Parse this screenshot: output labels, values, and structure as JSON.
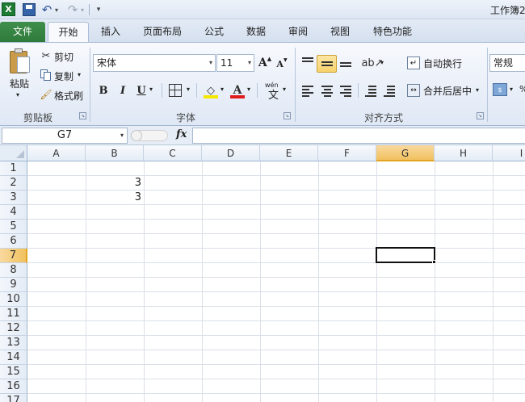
{
  "window": {
    "title": "工作簿2"
  },
  "quick_access": {
    "more_label": "▾"
  },
  "tabs": [
    {
      "label": "文件"
    },
    {
      "label": "开始"
    },
    {
      "label": "插入"
    },
    {
      "label": "页面布局"
    },
    {
      "label": "公式"
    },
    {
      "label": "数据"
    },
    {
      "label": "审阅"
    },
    {
      "label": "视图"
    },
    {
      "label": "特色功能"
    }
  ],
  "ribbon": {
    "clipboard": {
      "paste": "粘贴",
      "cut": "剪切",
      "copy": "复制",
      "format_painter": "格式刷",
      "group_label": "剪贴板"
    },
    "font": {
      "font_name": "宋体",
      "font_size": "11",
      "bold": "B",
      "italic": "I",
      "underline": "U",
      "phonetic": "wén",
      "phonetic_char": "文",
      "group_label": "字体",
      "grow": "A",
      "shrink": "A",
      "font_color_glyph": "A"
    },
    "alignment": {
      "wrap_text": "自动换行",
      "merge_center": "合并后居中",
      "group_label": "对齐方式"
    },
    "number": {
      "format": "常规"
    }
  },
  "formula_bar": {
    "name_box": "G7",
    "fx": "fx",
    "content": ""
  },
  "sheet": {
    "columns": [
      "A",
      "B",
      "C",
      "D",
      "E",
      "F",
      "G",
      "H",
      "I"
    ],
    "rows": [
      "1",
      "2",
      "3",
      "4",
      "5",
      "6",
      "7",
      "8",
      "9",
      "10",
      "11",
      "12",
      "13",
      "14",
      "15",
      "16",
      "17"
    ],
    "selected_column": "G",
    "selected_row": "7",
    "cells": {
      "B2": "3",
      "B3": "3"
    }
  },
  "colors": {
    "file_tab": "#2e7a3a",
    "selected_header": "#f1c15f",
    "ribbon_bg": "#dfe8f5"
  }
}
